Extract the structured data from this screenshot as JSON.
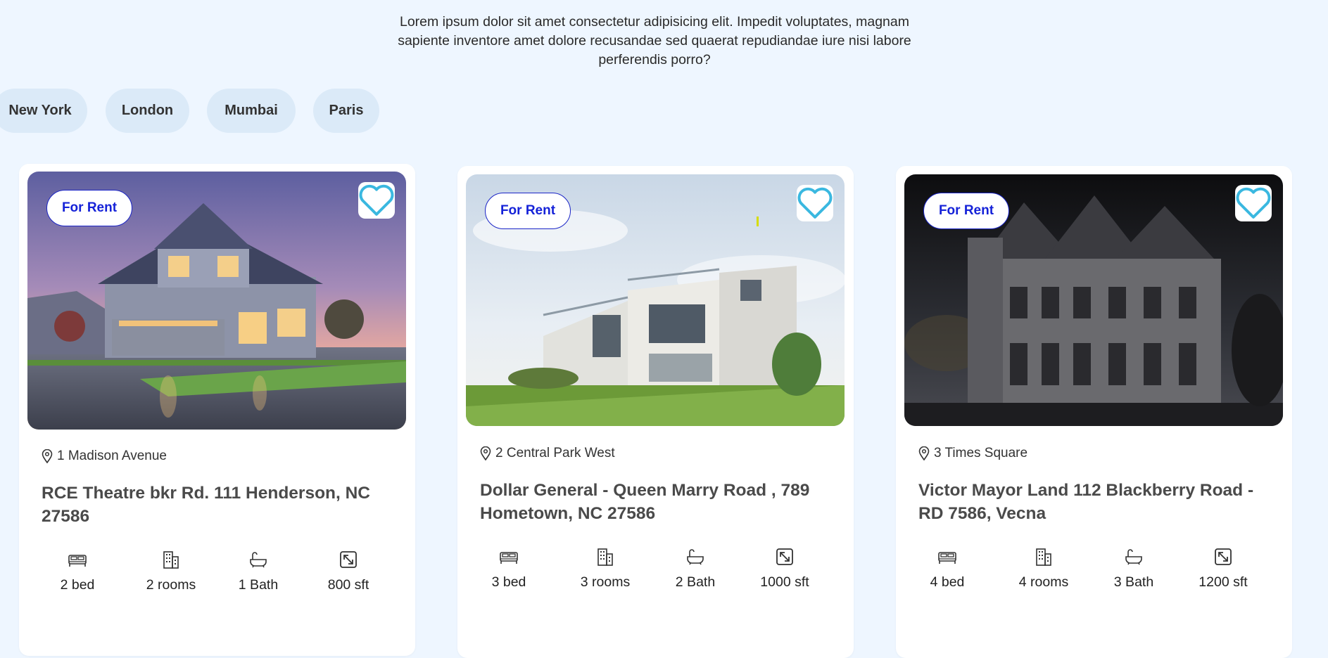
{
  "intro": "Lorem ipsum dolor sit amet consectetur adipisicing elit. Impedit voluptates, magnam sapiente inventore amet dolore recusandae sed quaerat repudiandae iure nisi labore perferendis porro?",
  "cities": [
    "New York",
    "London",
    "Mumbai",
    "Paris"
  ],
  "colors": {
    "page_bg": "#eef6ff",
    "badge": "#1522d8",
    "heart": "#3ab8e0"
  },
  "cards": [
    {
      "badge": "For Rent",
      "address": "1 Madison Avenue",
      "title": "RCE Theatre bkr Rd. 111 Henderson, NC 27586",
      "features": [
        {
          "icon": "bed-icon",
          "label": "2 bed"
        },
        {
          "icon": "building-icon",
          "label": "2 rooms"
        },
        {
          "icon": "bathtub-icon",
          "label": "1 Bath"
        },
        {
          "icon": "area-icon",
          "label": "800 sft"
        }
      ]
    },
    {
      "badge": "For Rent",
      "address": "2 Central Park West",
      "title": "Dollar General - Queen Marry Road , 789 Hometown, NC 27586",
      "features": [
        {
          "icon": "bed-icon",
          "label": "3 bed"
        },
        {
          "icon": "building-icon",
          "label": "3 rooms"
        },
        {
          "icon": "bathtub-icon",
          "label": "2 Bath"
        },
        {
          "icon": "area-icon",
          "label": "1000 sft"
        }
      ]
    },
    {
      "badge": "For Rent",
      "address": "3 Times Square",
      "title": "Victor Mayor Land 112 Blackberry Road - RD 7586, Vecna",
      "features": [
        {
          "icon": "bed-icon",
          "label": "4 bed"
        },
        {
          "icon": "building-icon",
          "label": "4 rooms"
        },
        {
          "icon": "bathtub-icon",
          "label": "3 Bath"
        },
        {
          "icon": "area-icon",
          "label": "1200 sft"
        }
      ]
    }
  ]
}
